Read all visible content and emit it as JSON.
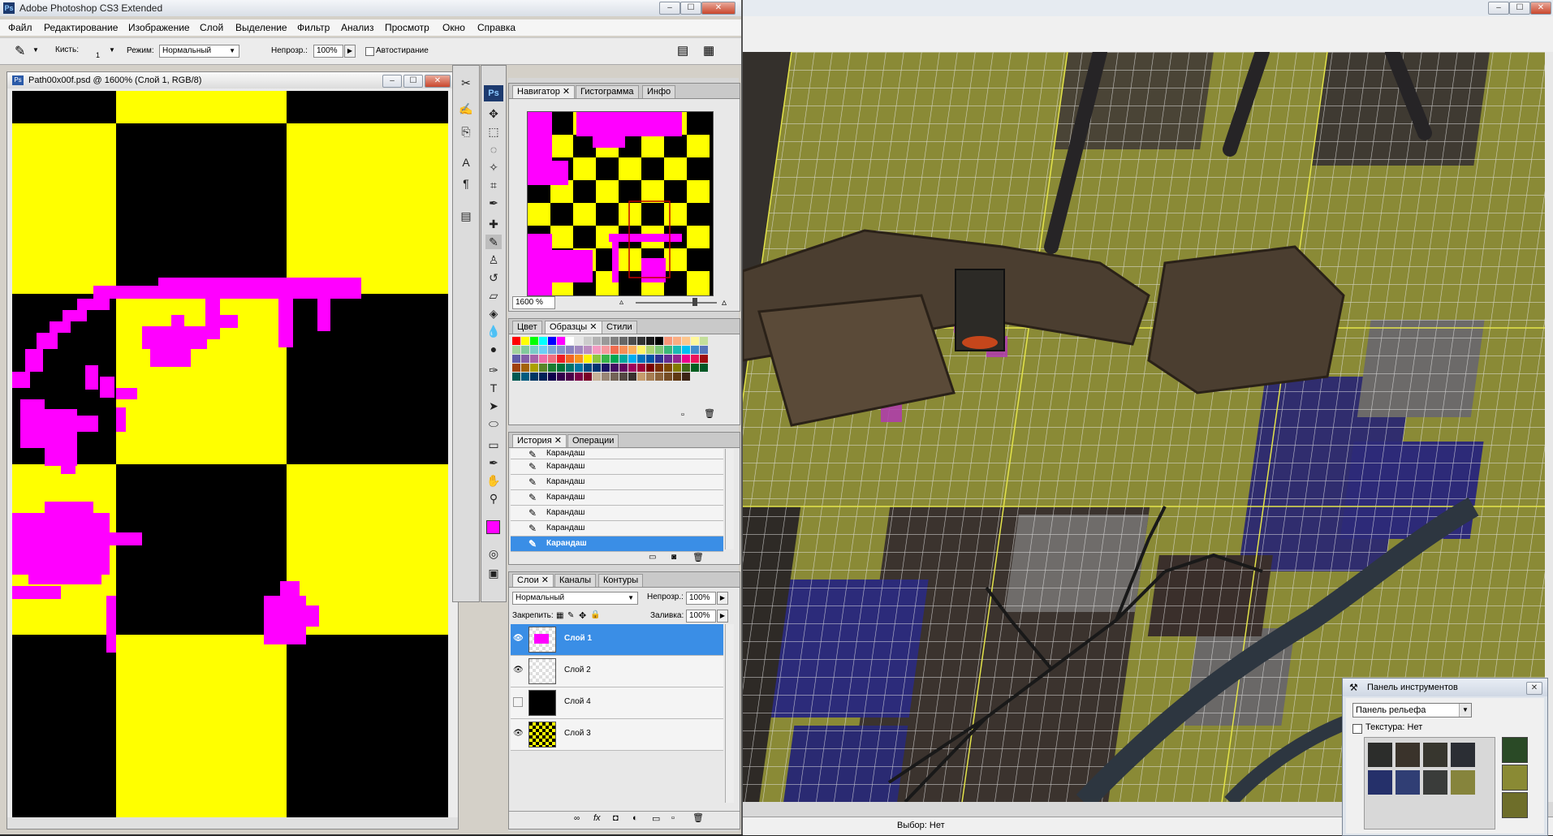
{
  "photoshop": {
    "title": "Adobe Photoshop CS3 Extended",
    "menu": [
      "Файл",
      "Редактирование",
      "Изображение",
      "Слой",
      "Выделение",
      "Фильтр",
      "Анализ",
      "Просмотр",
      "Окно",
      "Справка"
    ],
    "options": {
      "brush_label": "Кисть:",
      "brush_size": "1",
      "mode_label": "Режим:",
      "mode_value": "Нормальный",
      "opacity_label": "Непрозр.:",
      "opacity_value": "100%",
      "autoerase_label": "Автостирание"
    },
    "document": {
      "title": "Path00x00f.psd @ 1600% (Слой 1, RGB/8)"
    },
    "navigator": {
      "tabs": [
        "Навигатор",
        "Гистограмма",
        "Инфо"
      ],
      "zoom": "1600 %"
    },
    "swatches": {
      "tabs": [
        "Цвет",
        "Образцы",
        "Стили"
      ]
    },
    "history": {
      "tabs": [
        "История",
        "Операции"
      ],
      "items": [
        "Карандаш",
        "Карандаш",
        "Карандаш",
        "Карандаш",
        "Карандаш",
        "Карандаш",
        "Карандаш"
      ]
    },
    "layers": {
      "tabs": [
        "Слои",
        "Каналы",
        "Контуры"
      ],
      "blend_mode": "Нормальный",
      "opacity_label": "Непрозр.:",
      "opacity_value": "100%",
      "lock_label": "Закрепить:",
      "fill_label": "Заливка:",
      "fill_value": "100%",
      "items": [
        {
          "name": "Слой 1",
          "visible": true,
          "selected": true
        },
        {
          "name": "Слой 2",
          "visible": true,
          "selected": false
        },
        {
          "name": "Слой 4",
          "visible": false,
          "selected": false
        },
        {
          "name": "Слой 3",
          "visible": true,
          "selected": false
        }
      ]
    }
  },
  "editor": {
    "status": "Выбор: Нет",
    "tool_panel": {
      "title": "Панель инструментов",
      "dropdown_value": "Панель рельефа",
      "texture_label": "Текстура: Нет"
    }
  },
  "colors": {
    "yellow": "#ffff00",
    "magenta": "#ff00ff",
    "selection_blue": "#3a8ee6"
  }
}
